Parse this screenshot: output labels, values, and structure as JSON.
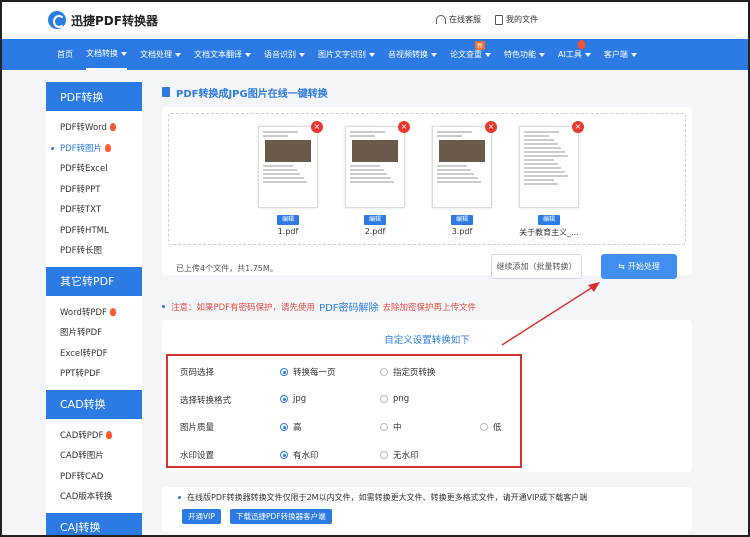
{
  "header": {
    "logo_text": "迅捷PDF转换器",
    "support_label": "在线客服",
    "docs_label": "我的文件"
  },
  "nav": [
    {
      "label": "首页",
      "caret": false
    },
    {
      "label": "文档转换",
      "caret": true
    },
    {
      "label": "文档处理",
      "caret": true
    },
    {
      "label": "文档文本翻译",
      "caret": true
    },
    {
      "label": "语音识别",
      "caret": true
    },
    {
      "label": "图片文字识别",
      "caret": true
    },
    {
      "label": "音视频转换",
      "caret": true
    },
    {
      "label": "论文查重",
      "caret": true,
      "badge": "新"
    },
    {
      "label": "特色功能",
      "caret": true
    },
    {
      "label": "AI工具",
      "caret": true,
      "fire": true
    },
    {
      "label": "客户端",
      "caret": true
    }
  ],
  "sidebar": [
    {
      "title": "PDF转换",
      "items": [
        {
          "label": "PDF转Word",
          "fire": true
        },
        {
          "label": "PDF转图片",
          "fire": true,
          "active": true
        },
        {
          "label": "PDF转Excel"
        },
        {
          "label": "PDF转PPT"
        },
        {
          "label": "PDF转TXT"
        },
        {
          "label": "PDF转HTML"
        },
        {
          "label": "PDF转长图"
        }
      ]
    },
    {
      "title": "其它转PDF",
      "items": [
        {
          "label": "Word转PDF",
          "fire": true
        },
        {
          "label": "图片转PDF"
        },
        {
          "label": "Excel转PDF"
        },
        {
          "label": "PPT转PDF"
        }
      ]
    },
    {
      "title": "CAD转换",
      "items": [
        {
          "label": "CAD转PDF",
          "fire": true
        },
        {
          "label": "CAD转图片"
        },
        {
          "label": "PDF转CAD"
        },
        {
          "label": "CAD版本转换"
        }
      ]
    },
    {
      "title": "CAJ转换",
      "items": []
    }
  ],
  "main": {
    "title": "PDF转换成JPG图片在线一键转换",
    "files": [
      {
        "name": "1.pdf",
        "edit": "编辑"
      },
      {
        "name": "2.pdf",
        "edit": "编辑"
      },
      {
        "name": "3.pdf",
        "edit": "编辑"
      },
      {
        "name": "关于教育主义_...",
        "edit": "编辑"
      }
    ],
    "upload_info": "已上传4个文件，共1.75M。",
    "continue_label": "继续添加（批量转换）",
    "start_label": "开始处理",
    "notice_prefix": "注意：如果PDF有密码保护，请先使用",
    "notice_link": "PDF密码解除",
    "notice_suffix": "去除加密保护再上传文件",
    "settings_title": "自定义设置转换如下",
    "options": [
      {
        "label": "页码选择",
        "choices": [
          {
            "text": "转换每一页",
            "on": true
          },
          {
            "text": "指定页转换",
            "on": false
          }
        ]
      },
      {
        "label": "选择转换格式",
        "choices": [
          {
            "text": "jpg",
            "on": true
          },
          {
            "text": "png",
            "on": false
          }
        ]
      },
      {
        "label": "图片质量",
        "choices": [
          {
            "text": "高",
            "on": true
          },
          {
            "text": "中",
            "on": false
          },
          {
            "text": "低",
            "on": false
          }
        ]
      },
      {
        "label": "水印设置",
        "choices": [
          {
            "text": "有水印",
            "on": true
          },
          {
            "text": "无水印",
            "on": false
          }
        ]
      }
    ],
    "footer_text": "在线版PDF转换器转换文件仅限于2M以内文件，如需转换更大文件、转换更多格式文件，请开通VIP或下载客户端",
    "vip_label": "开通VIP",
    "download_label": "下载迅捷PDF转换器客户端"
  },
  "colors": {
    "accent": "#2c7be5",
    "warning": "#e84a3f",
    "highlight_box": "#d9322e"
  }
}
